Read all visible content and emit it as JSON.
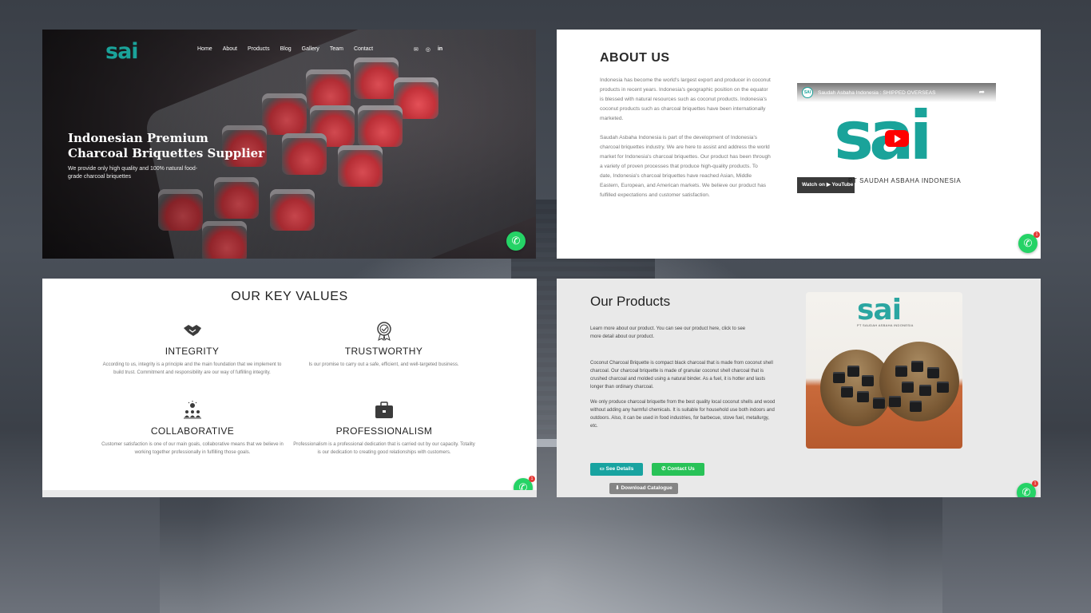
{
  "hero": {
    "logo": "sai",
    "nav": [
      "Home",
      "About",
      "Products",
      "Blog",
      "Gallery",
      "Team",
      "Contact"
    ],
    "nav_icons": [
      "mail-icon",
      "instagram-icon",
      "linkedin-icon"
    ],
    "title": "Indonesian Premium\nCharcoal Briquettes Supplier",
    "subtitle": "We provide only high quality and 100% natural food-grade charcoal briquettes"
  },
  "about": {
    "title": "ABOUT US",
    "paragraph1": "Indonesia has become the world's largest export and producer in coconut products in recent years. Indonesia's geographic position on the equator is blessed with natural resources such as coconut products. Indonesia's coconut products such as charcoal briquettes have been internationally marketed.",
    "paragraph2": "Saudah Asbaha Indonesia is part of the development of Indonesia's charcoal briquettes industry. We are here to assist and address the world market for Indonesia's charcoal briquettes. Our product has been through a variety of proven processes that produce high-quality products. To date, Indonesia's charcoal briquettes have reached Asian, Middle Eastern, European, and American markets. We believe our product has fulfilled expectations and customer satisfaction.",
    "video": {
      "channel_badge": "SAI",
      "title": "Saudah Asbaha Indonesia : SHIPPED OVERSEAS",
      "logo": "sai",
      "caption": "PT SAUDAH ASBAHA INDONESIA",
      "watch_on": "Watch on",
      "platform": "YouTube"
    }
  },
  "values": {
    "title": "OUR KEY VALUES",
    "items": [
      {
        "icon": "handshake-icon",
        "title": "INTEGRITY",
        "text": "According to us, integrity is a principle and the main foundation that we implement to build trust. Commitment and responsibility are our way of fulfilling integrity."
      },
      {
        "icon": "award-medal-icon",
        "title": "TRUSTWORTHY",
        "text": "Is our promise to carry out a safe, efficient, and well-targeted business."
      },
      {
        "icon": "team-idea-icon",
        "title": "COLLABORATIVE",
        "text": "Customer satisfaction is one of our main goals, collaborative means that we believe in working together professionally in fulfilling those goals."
      },
      {
        "icon": "briefcase-icon",
        "title": "PROFESSIONALISM",
        "text": "Professionalism is a professional dedication that is carried out by our capacity. Totality is our dedication to creating good relationships with customers."
      }
    ]
  },
  "products": {
    "title": "Our Products",
    "intro": "Learn more about our product. You can see our product here, click to see more detail about our product.",
    "desc1": "Coconut Charcoal Briquette is compact black charcoal that is made from coconut shell charcoal. Our charcoal briquette is made of granular coconut shell charcoal that is crushed charcoal and molded using a natural binder. As a fuel, it is hotter and lasts longer than ordinary charcoal.",
    "desc2": "We only produce charcoal briquette from the best quality local coconut shells and wood without adding any harmful chemicals. It is suitable for household use both indoors and outdoors. Also, it can be used in food industries, for barbecue, stove fuel, metallurgy, etc.",
    "image_logo": "sai",
    "image_tag": "PT SAUDAH ASBAHA INDONESIA",
    "btn_details": "See Details",
    "btn_contact": "Contact Us",
    "btn_download": "Download Catalogue"
  },
  "whatsapp": {
    "badge": "1"
  },
  "colors": {
    "brand_teal": "#1aa39a",
    "whatsapp_green": "#25d366",
    "badge_red": "#e53935"
  }
}
